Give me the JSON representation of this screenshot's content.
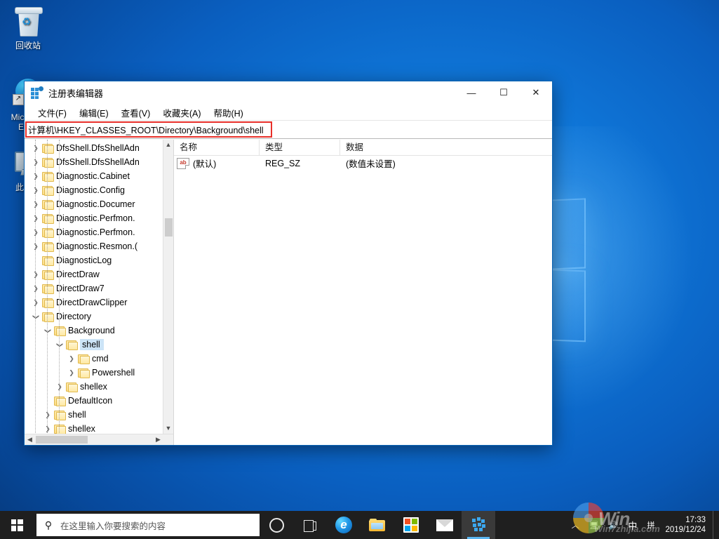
{
  "desktop": {
    "icons": [
      {
        "name": "recycle-bin",
        "label": "回收站"
      },
      {
        "name": "microsoft-edge",
        "label": "Microsoft Edge"
      },
      {
        "name": "this-pc",
        "label": "此电脑"
      }
    ]
  },
  "window": {
    "title": "注册表编辑器",
    "icon": "registry-editor-icon",
    "controls": {
      "minimize": "—",
      "maximize": "☐",
      "close": "✕"
    },
    "menu": [
      {
        "name": "file",
        "label": "文件(F)"
      },
      {
        "name": "edit",
        "label": "编辑(E)"
      },
      {
        "name": "view",
        "label": "查看(V)"
      },
      {
        "name": "favorites",
        "label": "收藏夹(A)"
      },
      {
        "name": "help",
        "label": "帮助(H)"
      }
    ],
    "address": {
      "value": "计算机\\HKEY_CLASSES_ROOT\\Directory\\Background\\shell",
      "highlight_color": "#e8302a"
    },
    "tree": {
      "nodes": [
        {
          "label": "DfsShell.DfsShellAdn",
          "depth": 1,
          "twist": "chevron-right",
          "selected": false
        },
        {
          "label": "DfsShell.DfsShellAdn",
          "depth": 1,
          "twist": "chevron-right",
          "selected": false
        },
        {
          "label": "Diagnostic.Cabinet",
          "depth": 1,
          "twist": "chevron-right",
          "selected": false
        },
        {
          "label": "Diagnostic.Config",
          "depth": 1,
          "twist": "chevron-right",
          "selected": false
        },
        {
          "label": "Diagnostic.Documer",
          "depth": 1,
          "twist": "chevron-right",
          "selected": false
        },
        {
          "label": "Diagnostic.Perfmon.",
          "depth": 1,
          "twist": "chevron-right",
          "selected": false
        },
        {
          "label": "Diagnostic.Perfmon.",
          "depth": 1,
          "twist": "chevron-right",
          "selected": false
        },
        {
          "label": "Diagnostic.Resmon.(",
          "depth": 1,
          "twist": "chevron-right",
          "selected": false
        },
        {
          "label": "DiagnosticLog",
          "depth": 1,
          "twist": "none",
          "selected": false
        },
        {
          "label": "DirectDraw",
          "depth": 1,
          "twist": "chevron-right",
          "selected": false
        },
        {
          "label": "DirectDraw7",
          "depth": 1,
          "twist": "chevron-right",
          "selected": false
        },
        {
          "label": "DirectDrawClipper",
          "depth": 1,
          "twist": "chevron-right",
          "selected": false
        },
        {
          "label": "Directory",
          "depth": 1,
          "twist": "chevron-down",
          "selected": false
        },
        {
          "label": "Background",
          "depth": 2,
          "twist": "chevron-down",
          "selected": false
        },
        {
          "label": "shell",
          "depth": 3,
          "twist": "chevron-down",
          "selected": true
        },
        {
          "label": "cmd",
          "depth": 4,
          "twist": "chevron-right",
          "selected": false
        },
        {
          "label": "Powershell",
          "depth": 4,
          "twist": "chevron-right",
          "selected": false
        },
        {
          "label": "shellex",
          "depth": 3,
          "twist": "chevron-right",
          "selected": false
        },
        {
          "label": "DefaultIcon",
          "depth": 2,
          "twist": "none",
          "selected": false
        },
        {
          "label": "shell",
          "depth": 2,
          "twist": "chevron-right",
          "selected": false
        },
        {
          "label": "shellex",
          "depth": 2,
          "twist": "chevron-right",
          "selected": false
        }
      ]
    },
    "values": {
      "columns": [
        {
          "name": "column-name",
          "label": "名称"
        },
        {
          "name": "column-type",
          "label": "类型"
        },
        {
          "name": "column-data",
          "label": "数据"
        }
      ],
      "rows": [
        {
          "icon": "string-value-icon",
          "name": "(默认)",
          "type": "REG_SZ",
          "data": "(数值未设置)"
        }
      ]
    }
  },
  "taskbar": {
    "start": "start-button",
    "search": {
      "placeholder": "在这里输入你要搜索的内容",
      "value": ""
    },
    "buttons": [
      {
        "name": "cortana",
        "label": "Cortana"
      },
      {
        "name": "task-view",
        "label": "任务视图"
      },
      {
        "name": "edge",
        "label": "Microsoft Edge"
      },
      {
        "name": "file-explorer",
        "label": "文件资源管理器"
      },
      {
        "name": "microsoft-store",
        "label": "Microsoft Store"
      },
      {
        "name": "mail",
        "label": "邮件"
      },
      {
        "name": "registry-editor",
        "label": "注册表编辑器"
      }
    ],
    "tray": {
      "overflow": "︿",
      "network": "网络",
      "volume": "音量",
      "ime_mode": "中",
      "ime_pinyin": "拼",
      "time": "17:33",
      "date": "2019/12/24"
    }
  },
  "watermark": {
    "text": "Win",
    "subtext": "Win7zhijia.com"
  }
}
